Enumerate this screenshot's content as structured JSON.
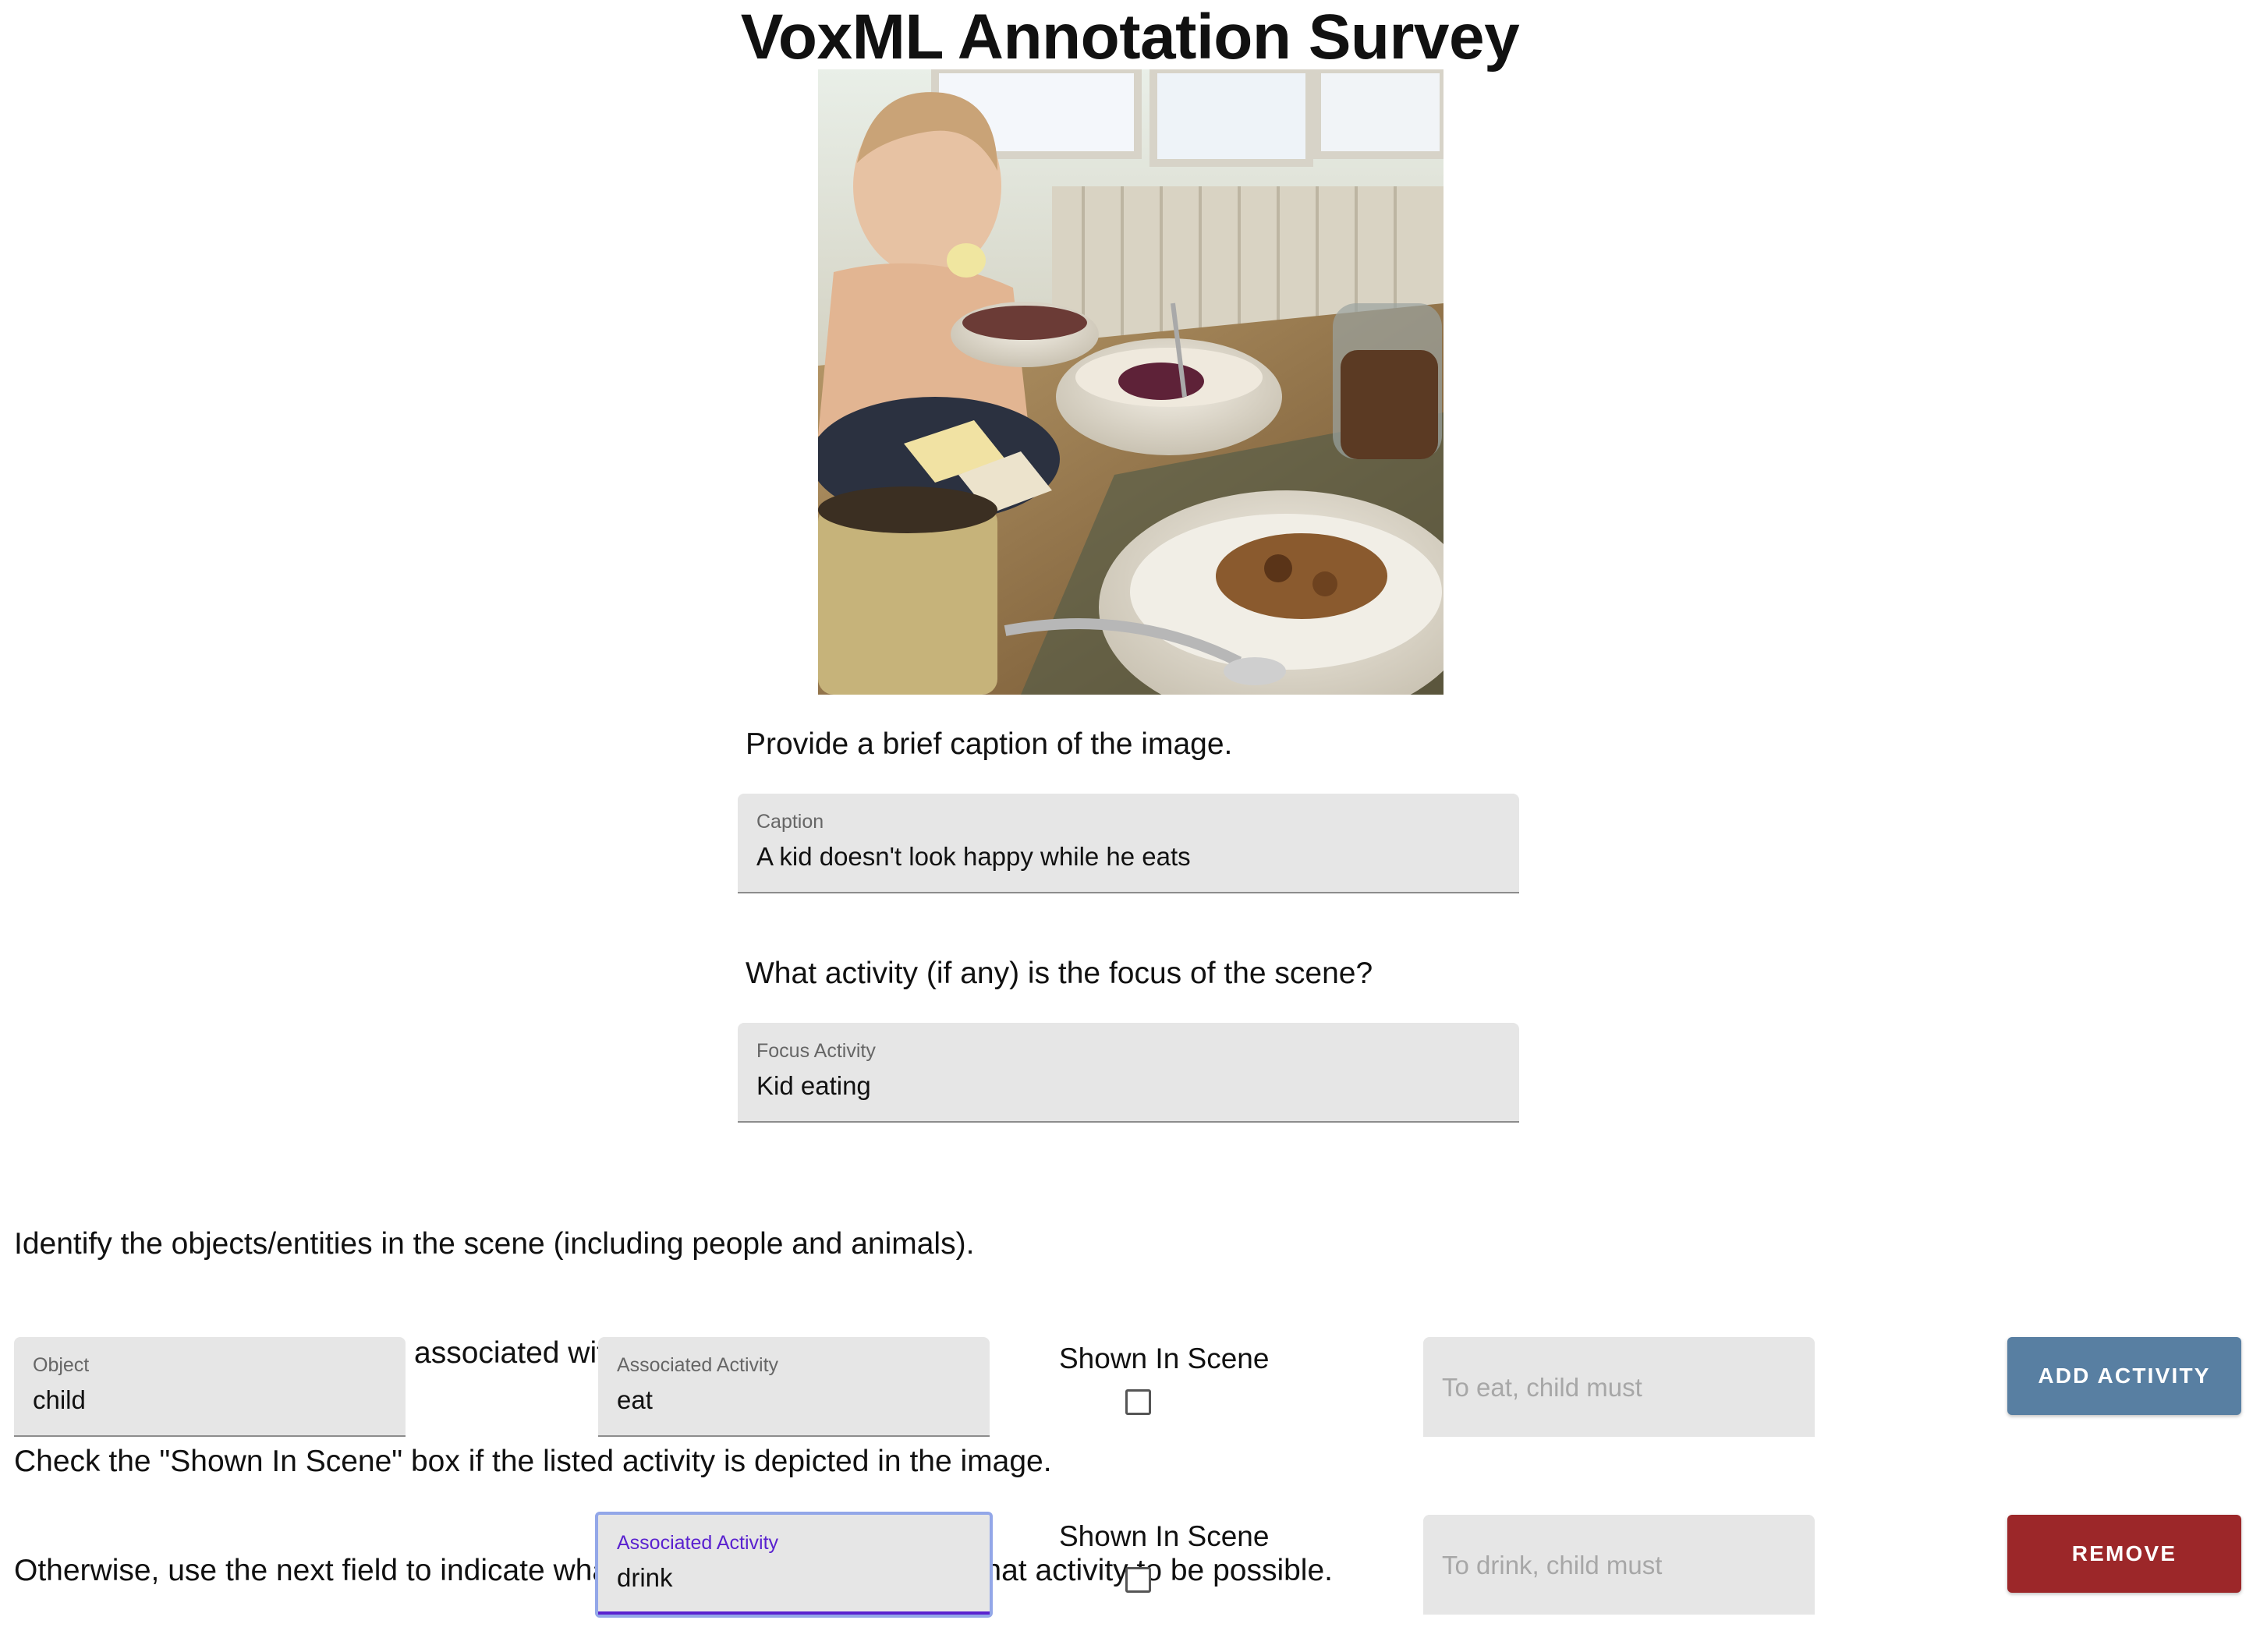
{
  "page": {
    "title": "VoxML Annotation Survey"
  },
  "caption_section": {
    "prompt": "Provide a brief caption of the image.",
    "field_label": "Caption",
    "value": "A kid doesn't look happy while he eats"
  },
  "focus_section": {
    "prompt": "What activity (if any) is the focus of the scene?",
    "field_label": "Focus Activity",
    "value": "Kid eating"
  },
  "instructions": [
    "Identify the objects/entities in the scene (including people and animals).",
    "For each entity, add activities associated with that object.",
    "Check the \"Shown In Scene\" box if the listed activity is depicted in the image.",
    "Otherwise, use the next field to indicate what would need to change for that activity to be possible."
  ],
  "entity": {
    "object_label": "Object",
    "object_value": "child",
    "activities": [
      {
        "activity_label": "Associated Activity",
        "activity_value": "eat",
        "shown_label": "Shown In Scene",
        "shown_checked": false,
        "change_placeholder": "To eat, child must",
        "button_label": "ADD ACTIVITY"
      },
      {
        "activity_label": "Associated Activity",
        "activity_value": "drink",
        "shown_label": "Shown In Scene",
        "shown_checked": false,
        "change_placeholder": "To drink, child must",
        "button_label": "REMOVE"
      }
    ]
  },
  "colors": {
    "add_button": "#587fa2",
    "remove_button": "#9c2729",
    "focus_accent": "#5a22cf",
    "field_background": "#e6e6e6"
  }
}
